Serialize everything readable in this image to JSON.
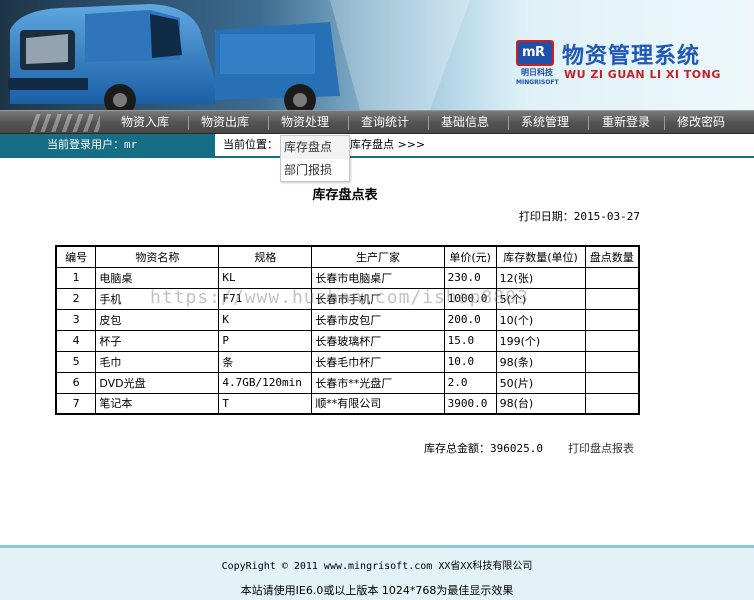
{
  "logo": {
    "mark_text": "明日科技",
    "company_en": "MINGRISOFT",
    "title_cn": "物资管理系统",
    "title_en": "WU ZI GUAN LI XI TONG"
  },
  "nav": {
    "items": [
      {
        "label": "物资入库"
      },
      {
        "label": "物资出库"
      },
      {
        "label": "物资处理"
      },
      {
        "label": "查询统计"
      },
      {
        "label": "基础信息"
      },
      {
        "label": "系统管理"
      },
      {
        "label": "重新登录"
      },
      {
        "label": "修改密码"
      }
    ],
    "dropdown": [
      {
        "label": "库存盘点"
      },
      {
        "label": "部门报损"
      }
    ]
  },
  "status": {
    "user_label": "当前登录用户：mr",
    "crumb_prefix": "当前位置：",
    "crumb_tail": "库存盘点 >>>"
  },
  "report": {
    "title": "库存盘点表",
    "print_date": "打印日期：2015-03-27",
    "columns": [
      "编号",
      "物资名称",
      "规格",
      "生产厂家",
      "单价(元)",
      "库存数量(单位)",
      "盘点数量"
    ],
    "rows": [
      {
        "id": "1",
        "name": "电脑桌",
        "spec": "KL",
        "maker": "长春市电脑桌厂",
        "price": "230.0",
        "qty": "12(张)",
        "count": ""
      },
      {
        "id": "2",
        "name": "手机",
        "spec": "F71",
        "maker": "长春市手机厂",
        "price": "1000.0",
        "qty": "5(个)",
        "count": ""
      },
      {
        "id": "3",
        "name": "皮包",
        "spec": "K",
        "maker": "长春市皮包厂",
        "price": "200.0",
        "qty": "10(个)",
        "count": ""
      },
      {
        "id": "4",
        "name": "杯子",
        "spec": "P",
        "maker": "长春玻璃杯厂",
        "price": "15.0",
        "qty": "199(个)",
        "count": ""
      },
      {
        "id": "5",
        "name": "毛巾",
        "spec": "条",
        "maker": "长春毛巾杯厂",
        "price": "10.0",
        "qty": "98(条)",
        "count": ""
      },
      {
        "id": "6",
        "name": "DVD光盘",
        "spec": "4.7GB/120min",
        "maker": "长春市**光盘厂",
        "price": "2.0",
        "qty": "50(片)",
        "count": ""
      },
      {
        "id": "7",
        "name": "笔记本",
        "spec": "T",
        "maker": "顺**有限公司",
        "price": "3900.0",
        "qty": "98(台)",
        "count": ""
      }
    ],
    "total": "库存总金额：396025.0",
    "print_link": "打印盘点报表"
  },
  "watermark": "https://www.huzhan.com/ishop8803",
  "footer": {
    "copyright": "CopyRight © 2011 www.mingrisoft.com XX省XX科技有限公司",
    "note": "本站请使用IE6.0或以上版本 1024*768为最佳显示效果"
  }
}
